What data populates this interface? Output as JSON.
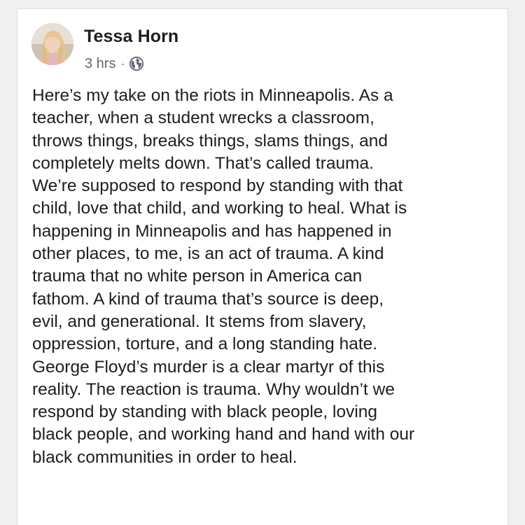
{
  "post": {
    "author": "Tessa Horn",
    "timestamp": "3 hrs",
    "separator": "·",
    "privacy_icon": "globe-icon",
    "text_lines": [
      "Here’s my take on the riots in Minneapolis. As a",
      "teacher, when a student wrecks a classroom,",
      "throws things, breaks things, slams things, and",
      "completely melts down. That’s called trauma.",
      "We’re supposed to respond by standing with that",
      "child, love that child, and working to heal. What is",
      "happening in Minneapolis and has happened in",
      "other places, to me, is an act of trauma. A kind",
      "trauma that no white person in America can",
      "fathom. A kind of trauma that’s source is deep,",
      "evil, and generational. It stems from slavery,",
      "oppression, torture, and a long standing hate.",
      "George Floyd’s murder is a clear martyr of this",
      "reality. The reaction is trauma. Why wouldn’t we",
      "respond by standing with black people, loving",
      "black people, and working hand and hand with our",
      "black communities in order to heal."
    ]
  }
}
